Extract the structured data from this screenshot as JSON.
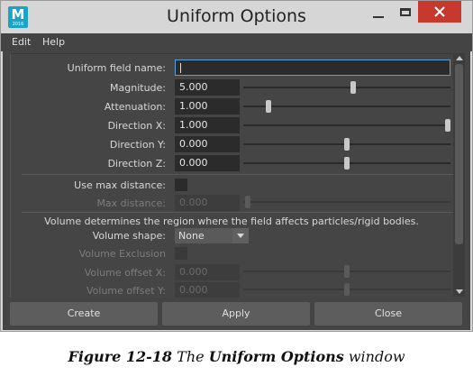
{
  "window": {
    "title": "Uniform Options",
    "app_icon": {
      "letter": "M",
      "sub": "2016"
    },
    "controls": [
      "minimize-icon",
      "maximize-icon",
      "close-icon"
    ],
    "close_color": "#c7382f"
  },
  "menubar": {
    "items": [
      "Edit",
      "Help"
    ]
  },
  "form": {
    "uniform_field_name": {
      "label": "Uniform field name:",
      "value": ""
    },
    "sliders": [
      {
        "label": "Magnitude:",
        "value": "5.000",
        "level": 0.53,
        "enabled": true
      },
      {
        "label": "Attenuation:",
        "value": "1.000",
        "level": 0.12,
        "enabled": true
      },
      {
        "label": "Direction X:",
        "value": "1.000",
        "level": 1.0,
        "enabled": true
      },
      {
        "label": "Direction Y:",
        "value": "0.000",
        "level": 0.5,
        "enabled": true
      },
      {
        "label": "Direction Z:",
        "value": "0.000",
        "level": 0.5,
        "enabled": true
      }
    ],
    "use_max_distance": {
      "label": "Use max distance:",
      "checked": false
    },
    "max_distance": {
      "label": "Max distance:",
      "value": "0.000",
      "level": 0.02,
      "enabled": false
    },
    "volume_info": "Volume determines the region where the field affects particles/rigid bodies.",
    "volume_shape": {
      "label": "Volume shape:",
      "value": "None"
    },
    "volume_exclusion": {
      "label": "Volume Exclusion",
      "checked": false,
      "enabled": false
    },
    "volume_offsets": [
      {
        "label": "Volume offset X:",
        "value": "0.000",
        "level": 0.5,
        "enabled": false
      },
      {
        "label": "Volume offset Y:",
        "value": "0.000",
        "level": 0.5,
        "enabled": false
      }
    ]
  },
  "buttons": {
    "create": "Create",
    "apply": "Apply",
    "close": "Close"
  },
  "caption": {
    "figure": "Figure 12-18",
    "the": "The",
    "name": "Uniform Options",
    "suffix": "window"
  },
  "colors": {
    "panel": "#444444",
    "field": "#2b2b2b",
    "focus": "#5c9ed6"
  }
}
